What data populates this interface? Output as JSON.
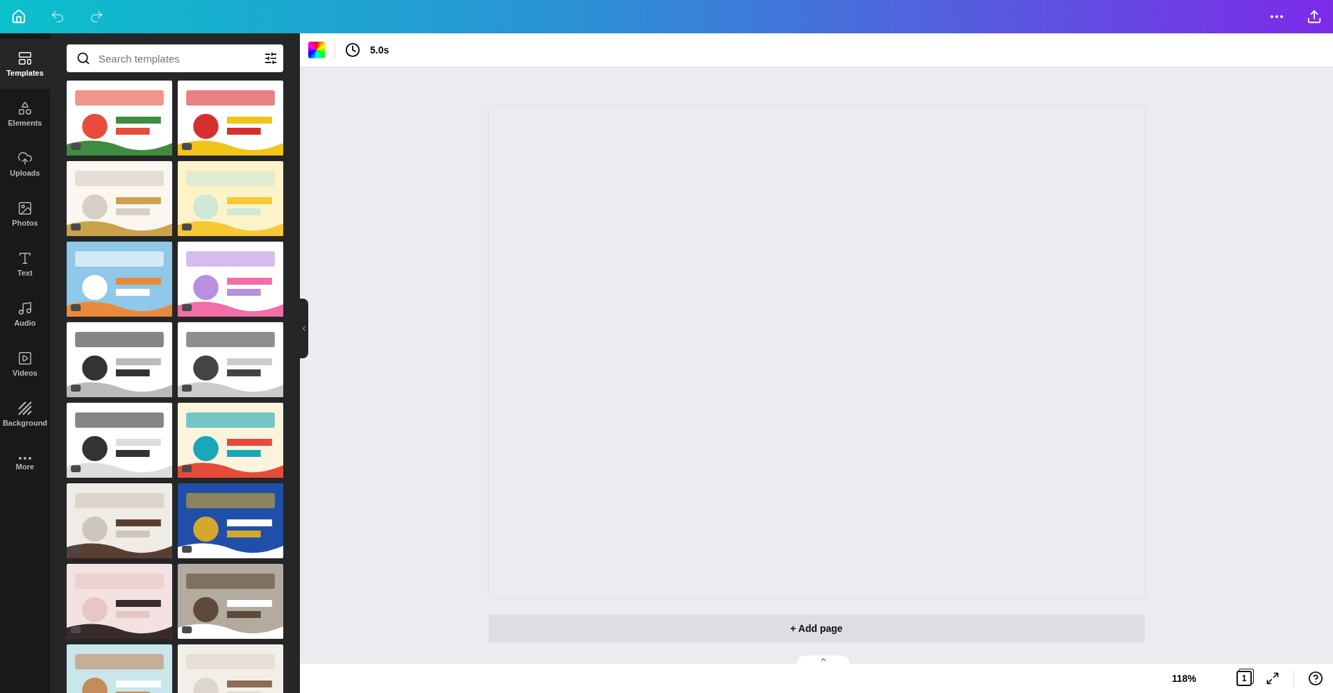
{
  "rail": [
    {
      "label": "Templates",
      "selected": true,
      "kind": "templates"
    },
    {
      "label": "Elements",
      "selected": false,
      "kind": "elements"
    },
    {
      "label": "Uploads",
      "selected": false,
      "kind": "uploads"
    },
    {
      "label": "Photos",
      "selected": false,
      "kind": "photos"
    },
    {
      "label": "Text",
      "selected": false,
      "kind": "text"
    },
    {
      "label": "Audio",
      "selected": false,
      "kind": "audio"
    },
    {
      "label": "Videos",
      "selected": false,
      "kind": "videos"
    },
    {
      "label": "Background",
      "selected": false,
      "kind": "background"
    },
    {
      "label": "More",
      "selected": false,
      "kind": "more"
    }
  ],
  "search": {
    "placeholder": "Search templates"
  },
  "toolbar": {
    "duration": "5.0s"
  },
  "add_page": "+ Add page",
  "footer": {
    "zoom": "118%",
    "page_count": "1"
  }
}
